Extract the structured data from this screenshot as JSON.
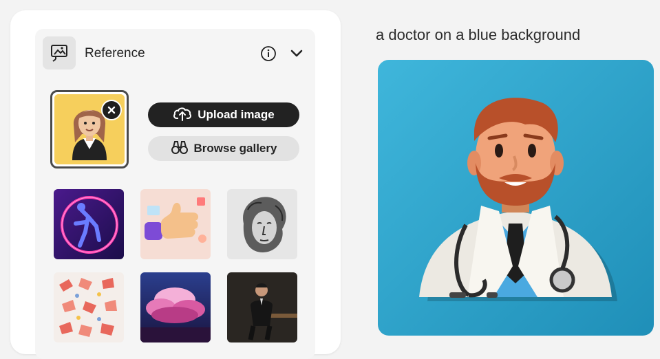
{
  "reference": {
    "title": "Reference",
    "icons": {
      "section": "reference-image-icon",
      "info": "info-icon",
      "toggle": "chevron-down-icon",
      "remove": "close-icon"
    }
  },
  "actions": {
    "upload_label": "Upload image",
    "browse_label": "Browse gallery",
    "upload_icon": "cloud-upload-icon",
    "browse_icon": "binoculars-icon"
  },
  "gallery": [
    "neon-dancer",
    "thumbs-up-3d",
    "engraving-portrait",
    "hands-pattern",
    "pink-clouds",
    "man-in-suit"
  ],
  "result": {
    "prompt": "a doctor on a blue background",
    "image": "doctor-papercraft"
  },
  "colors": {
    "accent_dark": "#222222",
    "result_bg": "#2fa3c8",
    "selected_bg": "#f6cf5c"
  }
}
